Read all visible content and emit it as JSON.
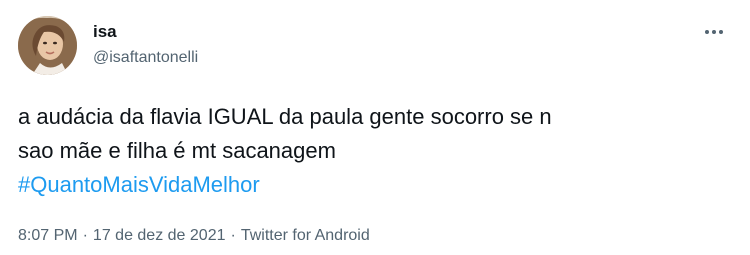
{
  "author": {
    "display_name": "isa",
    "handle": "@isaftantonelli",
    "avatar_icon": "avatar-photo"
  },
  "more_icon": "more-options-icon",
  "tweet": {
    "line1": "a audácia da flavia IGUAL da paula gente socorro se n",
    "line2": "sao mãe e filha é mt sacanagem",
    "hashtag": "#QuantoMaisVidaMelhor"
  },
  "meta": {
    "time": "8:07 PM",
    "separator": "·",
    "date": "17 de dez de 2021",
    "source": "Twitter for Android"
  },
  "colors": {
    "text": "#0f1419",
    "secondary": "#536471",
    "link": "#1d9bf0",
    "background": "#ffffff"
  }
}
